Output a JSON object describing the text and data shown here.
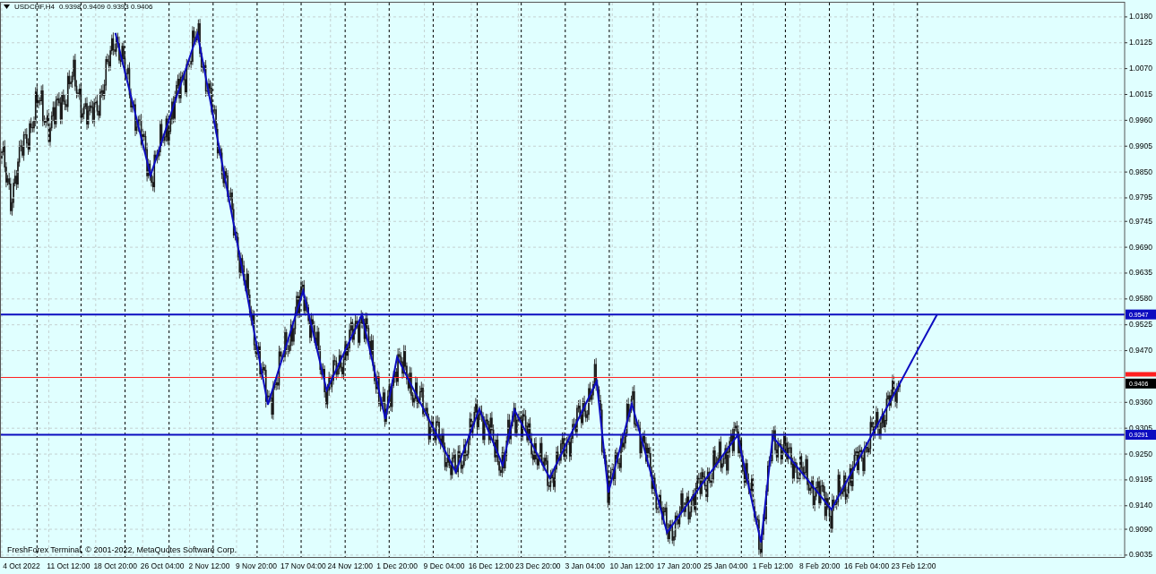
{
  "chart_window": {
    "title": "USDCHF,H4",
    "quote": [
      "0.9398",
      "0.9409",
      "0.9393",
      "0.9406"
    ],
    "copyright": "FreshForex Terminal, © 2001-2022, MetaQuotes Software Corp.",
    "chart_data": {
      "type": "line",
      "ylim": [
        0.9031,
        1.0216
      ],
      "grid": true,
      "categories": [
        "4 Oct 2022",
        null,
        null,
        null,
        "11 Oct 12:00",
        null,
        null,
        null,
        "18 Oct 20:00",
        null,
        null,
        null,
        "26 Oct 04:00",
        null,
        null,
        null,
        "2 Nov 12:00",
        null,
        null,
        null,
        "9 Nov 20:00",
        null,
        null,
        null,
        "17 Nov 04:00",
        null,
        null,
        null,
        "24 Nov 12:00",
        null,
        null,
        null,
        "1 Dec 20:00",
        null,
        null,
        null,
        "9 Dec 04:00",
        null,
        null,
        null,
        "16 Dec 12:00",
        null,
        null,
        null,
        "23 Dec 20:00",
        null,
        null,
        null,
        "3 Jan 04:00",
        null,
        null,
        null,
        "10 Jan 12:00",
        null,
        null,
        null,
        "17 Jan 20:00",
        null,
        null,
        null,
        "25 Jan 04:00",
        null,
        null,
        null,
        "1 Feb 12:00",
        null,
        null,
        null,
        "8 Feb 20:00",
        null,
        null,
        null,
        "16 Feb 04:00",
        null,
        null,
        null,
        "23 Feb 12:00",
        null,
        null,
        null,
        null,
        null,
        null,
        null,
        null,
        null,
        null,
        null,
        null,
        null,
        null,
        null,
        null,
        null,
        null
      ],
      "series": [
        {
          "color": "#0c0cc0",
          "values": [
            null,
            null,
            null,
            null,
            null,
            null,
            null,
            null,
            1.0146,
            1.0045,
            0.9944,
            0.9843,
            0.9918,
            0.9994,
            1.0069,
            1.0144,
            1.0013,
            0.9881,
            0.975,
            0.9618,
            0.9487,
            0.9355,
            0.9436,
            0.9516,
            0.9597,
            0.9492,
            0.9386,
            0.9439,
            0.9493,
            0.9546,
            0.9436,
            0.9325,
            0.9456,
            0.9407,
            0.9358,
            0.931,
            0.9261,
            0.9212,
            0.9279,
            0.9346,
            0.9286,
            0.9226,
            0.9344,
            0.9296,
            0.9247,
            0.9199,
            0.925,
            0.9302,
            0.9353,
            0.9405,
            0.9168,
            0.9263,
            0.9357,
            0.9266,
            0.9174,
            0.9083,
            0.9118,
            0.9152,
            0.9187,
            0.9221,
            0.9256,
            0.929,
            0.9176,
            0.9062,
            0.9287,
            0.9256,
            0.9225,
            0.9194,
            0.9163,
            0.9132,
            0.9178,
            0.9224,
            0.927,
            0.9316,
            0.9362,
            0.9408,
            0.9455,
            0.9501,
            0.9547,
            null,
            null,
            null,
            null,
            null,
            null,
            null,
            null,
            null,
            null,
            null,
            null,
            null,
            null,
            null,
            null
          ]
        }
      ],
      "yticks": [
        {
          "value": 1.018,
          "label": "1.0180"
        },
        {
          "value": 1.0125,
          "label": "1.0125"
        },
        {
          "value": 1.007,
          "label": "1.0070"
        },
        {
          "value": 1.0015,
          "label": "1.0015"
        },
        {
          "value": 0.996,
          "label": "0.9960"
        },
        {
          "value": 0.9905,
          "label": "0.9905"
        },
        {
          "value": 0.985,
          "label": "0.9850"
        },
        {
          "value": 0.9795,
          "label": "0.9795"
        },
        {
          "value": 0.9745,
          "label": "0.9745"
        },
        {
          "value": 0.969,
          "label": "0.9690"
        },
        {
          "value": 0.9635,
          "label": "0.9635"
        },
        {
          "value": 0.958,
          "label": "0.9580"
        },
        {
          "value": 0.9525,
          "label": "0.9525"
        },
        {
          "value": 0.947,
          "label": "0.9470"
        },
        {
          "value": 0.936,
          "label": "0.9360"
        },
        {
          "value": 0.9305,
          "label": "0.9305"
        },
        {
          "value": 0.925,
          "label": "0.9250"
        },
        {
          "value": 0.9195,
          "label": "0.9195"
        },
        {
          "value": 0.914,
          "label": "0.9140"
        },
        {
          "value": 0.909,
          "label": "0.9090"
        },
        {
          "value": 0.9035,
          "label": "0.9035"
        }
      ],
      "ref_lines": [
        {
          "axis": "y",
          "value": 0.9547,
          "label": "0.9547",
          "color": "#0c0cc0"
        },
        {
          "axis": "y",
          "value": 0.9291,
          "label": "0.9291",
          "color": "#0c0cc0"
        },
        {
          "axis": "y",
          "value": 0.9413,
          "color": "#ff2020"
        }
      ],
      "annotations": [
        "0.9406"
      ]
    }
  }
}
